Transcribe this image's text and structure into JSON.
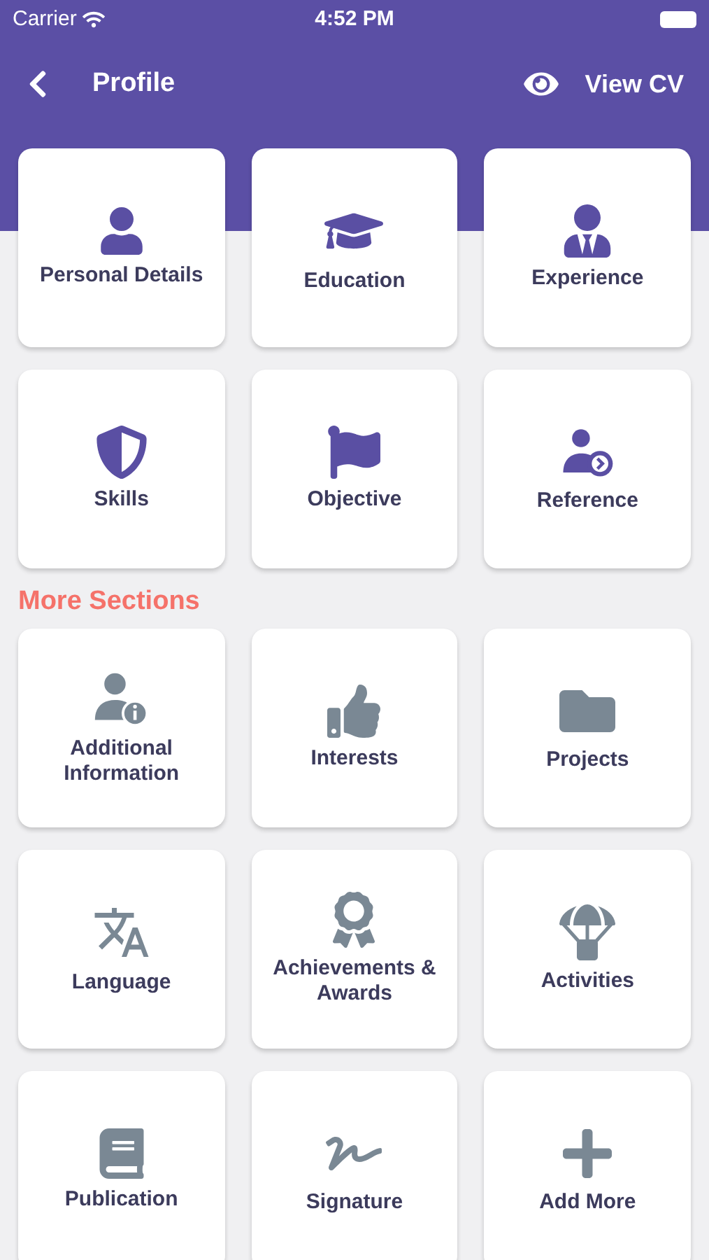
{
  "status_bar": {
    "carrier": "Carrier",
    "time": "4:52 PM"
  },
  "header": {
    "title": "Profile",
    "action": "View CV"
  },
  "sections": [
    {
      "kind": "primary",
      "items": [
        {
          "label": "Personal Details"
        },
        {
          "label": "Education"
        },
        {
          "label": "Experience"
        },
        {
          "label": "Skills"
        },
        {
          "label": "Objective"
        },
        {
          "label": "Reference"
        }
      ]
    },
    {
      "kind": "secondary",
      "title": "More Sections",
      "items": [
        {
          "label": "Additional Information"
        },
        {
          "label": "Interests"
        },
        {
          "label": "Projects"
        },
        {
          "label": "Language"
        },
        {
          "label": "Achievements & Awards"
        },
        {
          "label": "Activities"
        },
        {
          "label": "Publication"
        },
        {
          "label": "Signature"
        },
        {
          "label": "Add More"
        }
      ]
    }
  ]
}
